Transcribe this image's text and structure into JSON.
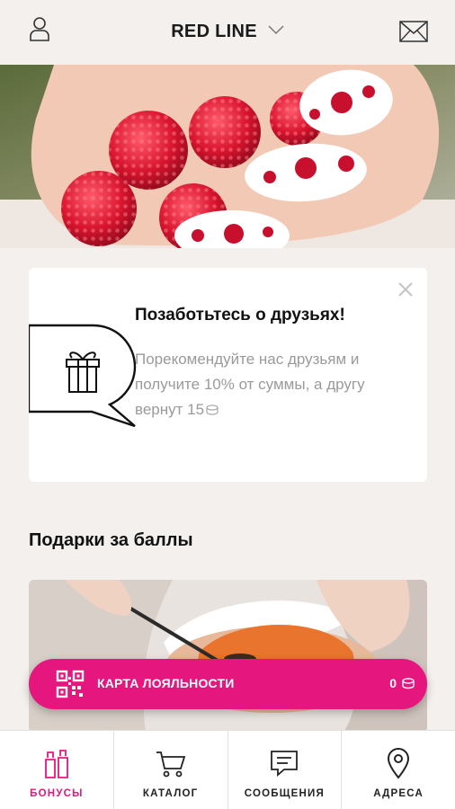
{
  "header": {
    "title": "RED LINE",
    "profile_icon": "user-icon",
    "mail_icon": "mail-icon"
  },
  "banner": {
    "slides": 2,
    "active_slide": 1
  },
  "promo": {
    "title": "Позаботьтесь о друзьях!",
    "text": "Порекомендуйте нас друзьям и получите 10% от суммы, а другу вернут 15",
    "icon": "gift-icon"
  },
  "section": {
    "title": "Подарки за баллы"
  },
  "loyalty": {
    "label": "КАРТА ЛОЯЛЬНОСТИ",
    "balance": "0"
  },
  "nav": {
    "items": [
      {
        "label": "БОНУСЫ",
        "icon": "bottles-icon",
        "active": true
      },
      {
        "label": "КАТАЛОГ",
        "icon": "cart-icon",
        "active": false
      },
      {
        "label": "СООБЩЕНИЯ",
        "icon": "chat-icon",
        "active": false
      },
      {
        "label": "АДРЕСА",
        "icon": "location-pin-icon",
        "active": false
      }
    ]
  },
  "colors": {
    "accent": "#e5177f",
    "background": "#f3f0ee",
    "card": "#ffffff",
    "muted_text": "#9a9a9a"
  }
}
